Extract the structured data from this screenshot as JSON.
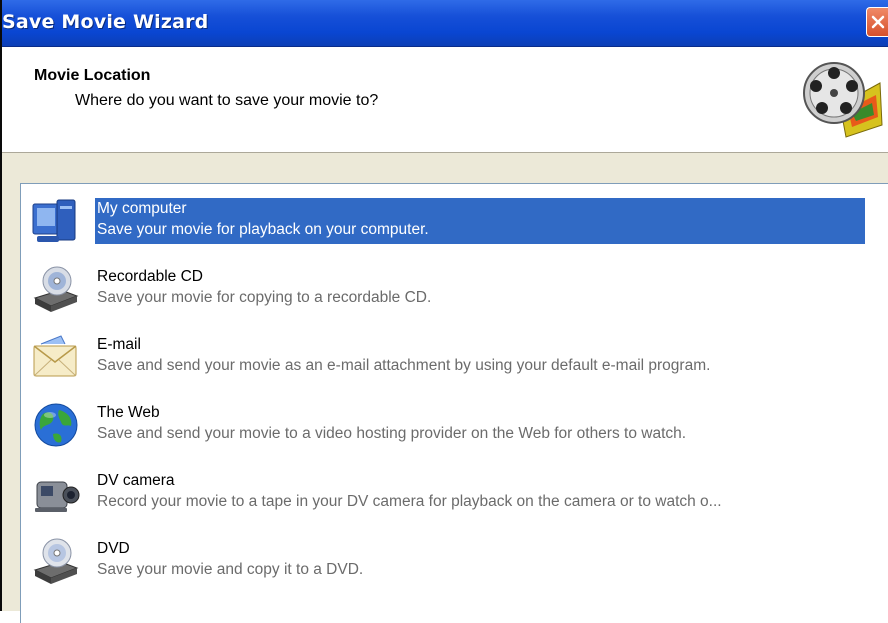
{
  "window": {
    "title": "Save Movie Wizard"
  },
  "header": {
    "title": "Movie Location",
    "subtitle": "Where do you want to save your movie to?"
  },
  "locations": [
    {
      "name": "My computer",
      "description": "Save your movie for playback on your computer.",
      "icon": "computer-icon",
      "selected": true
    },
    {
      "name": "Recordable CD",
      "description": "Save your movie for copying to a recordable CD.",
      "icon": "cd-drive-icon",
      "selected": false
    },
    {
      "name": "E-mail",
      "description": "Save and send your movie as an e-mail attachment by using your default e-mail program.",
      "icon": "email-icon",
      "selected": false
    },
    {
      "name": "The Web",
      "description": "Save and send your movie to a video hosting provider on the Web for others to watch.",
      "icon": "globe-icon",
      "selected": false
    },
    {
      "name": "DV camera",
      "description": "Record your movie to a tape in your DV camera for playback on the camera or to watch o...",
      "icon": "dv-camera-icon",
      "selected": false
    },
    {
      "name": "DVD",
      "description": "Save your movie and copy it to a DVD.",
      "icon": "dvd-drive-icon",
      "selected": false
    }
  ],
  "colors": {
    "titlebar": "#0a46d2",
    "selection": "#316ac5",
    "close": "#d6502c"
  }
}
